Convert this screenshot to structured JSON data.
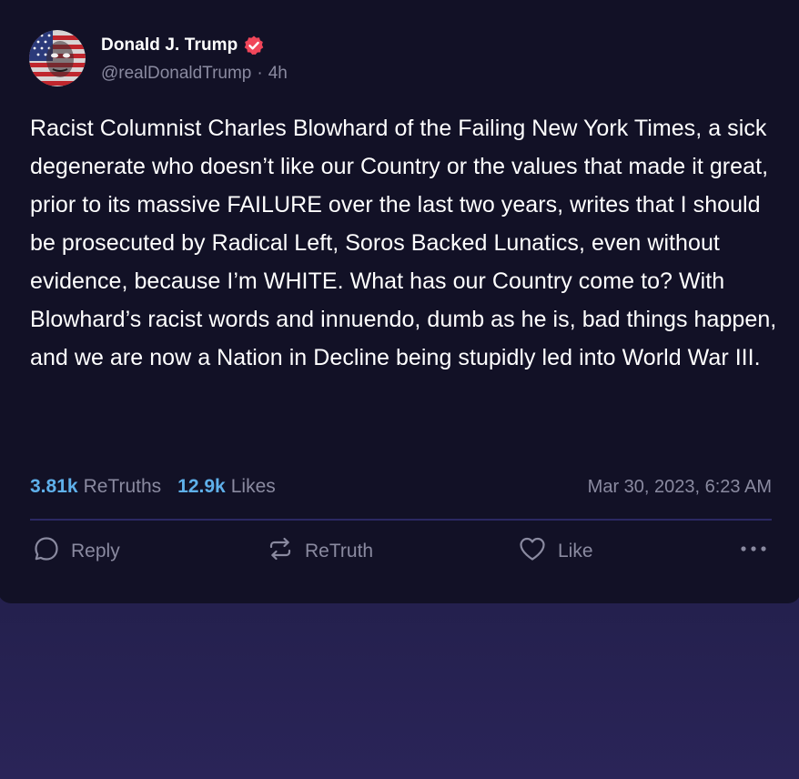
{
  "post": {
    "author": {
      "name": "Donald J. Trump",
      "handle": "@realDonaldTrump",
      "separator": "·",
      "age": "4h",
      "verified_icon": "verified-badge-icon",
      "verified_color": "#f0465a"
    },
    "text": "Racist Columnist Charles Blowhard of the Failing New York Times, a sick degenerate who doesn’t like our Country or the values that made it great, prior to its massive FAILURE over the last two years, writes that I should be prosecuted by Radical Left, Soros Backed Lunatics, even without evidence, because I’m WHITE. What has our Country come to? With Blowhard’s racist words and innuendo, dumb as he is, bad things happen, and we are now a Nation in Decline being stupidly led into World War III.",
    "stats": {
      "retruths_count": "3.81k",
      "retruths_label": "ReTruths",
      "likes_count": "12.9k",
      "likes_label": "Likes",
      "timestamp": "Mar 30, 2023, 6:23 AM"
    },
    "actions": {
      "reply_label": "Reply",
      "retruth_label": "ReTruth",
      "like_label": "Like"
    }
  },
  "colors": {
    "card_background": "#121126",
    "page_background": "#1f1c45",
    "accent_blue": "#5fb0ea",
    "muted_text": "#8a8aa0",
    "divider": "#2b2863"
  }
}
